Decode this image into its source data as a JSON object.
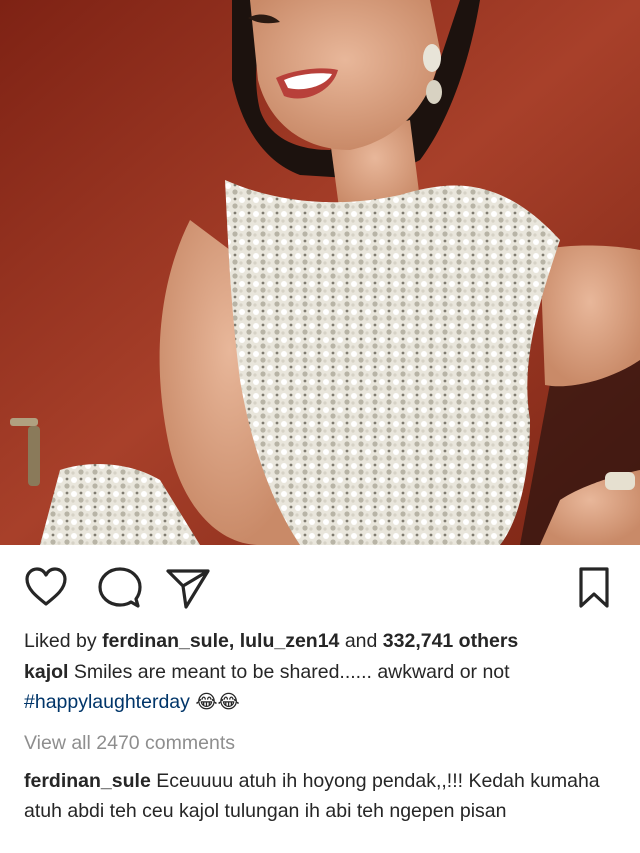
{
  "post": {
    "image_alt": "Photo of a smiling woman in a white sequined sleeveless top against a red wall"
  },
  "actions": {
    "like_icon": "heart-icon",
    "comment_icon": "comment-bubble-icon",
    "share_icon": "paper-plane-icon",
    "save_icon": "bookmark-icon"
  },
  "likes": {
    "prefix": "Liked by ",
    "user1": "ferdinan_sule",
    "sep": ", ",
    "user2": "lulu_zen14",
    "and": " and ",
    "others": "332,741 others"
  },
  "caption": {
    "author": "kajol",
    "text": "Smiles are meant to be shared...... awkward or not",
    "hashtag": "#happylaughterday",
    "emoji": "😂😂"
  },
  "comments": {
    "view_all": "View all 2470 comments",
    "items": [
      {
        "author": "ferdinan_sule",
        "text": "Eceuuuu atuh ih hoyong pendak,,!!! Kedah kumaha atuh abdi teh ceu kajol tulungan ih abi teh ngepen pisan"
      }
    ]
  },
  "colors": {
    "text": "#262626",
    "muted": "#8e8e8e",
    "hashtag": "#003569",
    "wall": "#9a3320"
  }
}
